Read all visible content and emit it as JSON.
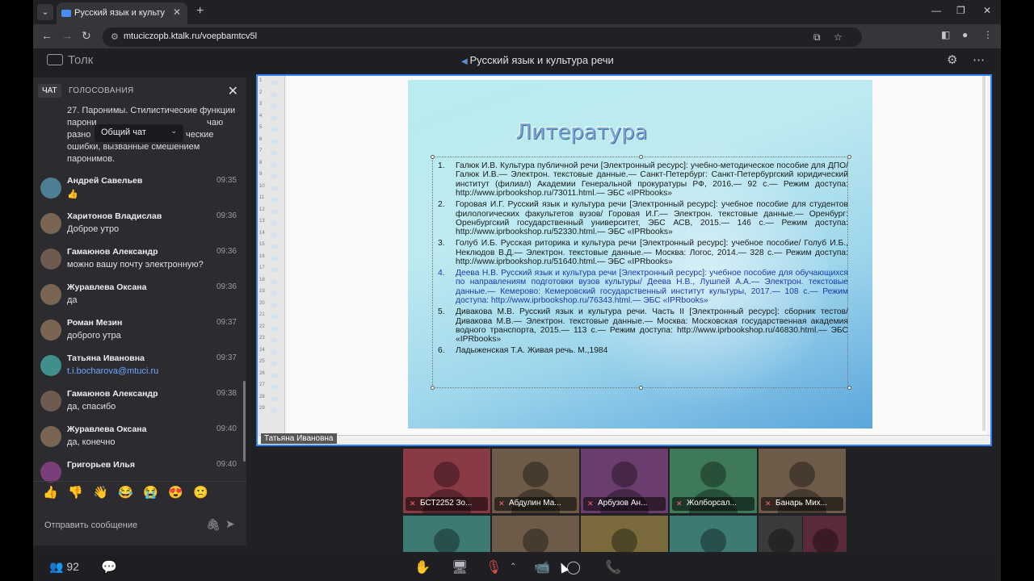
{
  "browser": {
    "tab_title": "Русский язык и культура р",
    "url": "mtuciczopb.ktalk.ru/voepbamtcv5l"
  },
  "app": {
    "logo_text": "Толк",
    "meeting_title": "Русский язык и культура речи"
  },
  "chat": {
    "tab_active": "ЧАТ",
    "tab_polls": "ГОЛОСОВАНИЯ",
    "selector": "Общий чат",
    "first_message_lines": [
      "27. Паронимы. Стилистические функции",
      "парони",
      "разно",
      "ошибки, вызванные смешением",
      "паронимов."
    ],
    "first_message_tails": [
      "чаю",
      "ческие"
    ],
    "messages": [
      {
        "name": "Андрей Савельев",
        "time": "09:35",
        "text": "👍",
        "color": "#4d7e93"
      },
      {
        "name": "Харитонов Владислав",
        "time": "09:36",
        "text": "Доброе утро",
        "color": "#7a6553"
      },
      {
        "name": "Гамаюнов Александр",
        "time": "09:36",
        "text": "можно вашу почту электронную?",
        "color": "#6e5a4e"
      },
      {
        "name": "Журавлева Оксана",
        "time": "09:36",
        "text": "да",
        "color": "#7a6553"
      },
      {
        "name": "Роман Мезин",
        "time": "09:37",
        "text": "доброго утра",
        "color": "#7a6553"
      },
      {
        "name": "Татьяна Ивановна",
        "time": "09:37",
        "text": "t.i.bocharova@mtuci.ru",
        "color": "#3f8f8b"
      },
      {
        "name": "Гамаюнов Александр",
        "time": "09:38",
        "text": "да, спасибо",
        "color": "#6e5a4e"
      },
      {
        "name": "Журавлева Оксана",
        "time": "09:40",
        "text": "да, конечно",
        "color": "#7a6553"
      },
      {
        "name": "Григорьев Илья",
        "time": "09:40",
        "text": "",
        "color": "#7a3f7a"
      }
    ],
    "reactions": [
      "👍",
      "👎",
      "👋",
      "😂",
      "😭",
      "😍",
      "🙁"
    ],
    "input_placeholder": "Отправить сообщение"
  },
  "slide": {
    "title": "Литература",
    "speaker": "Татьяна Ивановна",
    "references": [
      {
        "num": "1.",
        "text": "Галюк И.В. Культура публичной речи [Электронный ресурс]: учебно-методическое пособие для ДПО/ Галюк И.В.— Электрон. текстовые данные.— Санкт-Петербург: Санкт-Петербургский юридический институт (филиал) Академии Генеральной прокуратуры РФ, 2016.— 92 c.— Режим доступа: http://www.iprbookshop.ru/73011.html.— ЭБС «IPRbooks»"
      },
      {
        "num": "2.",
        "text": "Горовая И.Г. Русский язык и культура речи [Электронный ресурс]: учебное пособие для студентов филологических факультетов вузов/ Горовая И.Г.— Электрон. текстовые данные.— Оренбург: Оренбургский государственный университет, ЭБС АСВ, 2015.— 146 c.— Режим доступа: http://www.iprbookshop.ru/52330.html.— ЭБС «IPRbooks»"
      },
      {
        "num": "3.",
        "text": "Голуб И.Б. Русская риторика и культура речи [Электронный ресурс]: учебное пособие/ Голуб И.Б., Неклюдов В.Д.— Электрон. текстовые данные.— Москва: Логос, 2014.— 328 c.— Режим доступа: http://www.iprbookshop.ru/51640.html.— ЭБС «IPRbooks»"
      },
      {
        "num": "4.",
        "text": "Деева Н.В. Русский язык и культура речи [Электронный ресурс]: учебное пособие для обучающихся по направлениям подготовки вузов культуры/ Деева Н.В., Лушпей А.А.— Электрон. текстовые данные.— Кемерово: Кемеровский государственный институт культуры, 2017.— 108 c.— Режим доступа: http://www.iprbookshop.ru/76343.html.— ЭБС «IPRbooks»"
      },
      {
        "num": "5.",
        "text": "Дивакова М.В. Русский язык и культура речи. Часть II [Электронный ресурс]: сборник тестов/ Дивакова М.В.— Электрон. текстовые данные.— Москва: Московская государственная академия водного транспорта, 2015.— 113 c.— Режим доступа: http://www.iprbookshop.ru/46830.html.— ЭБС «IPRbooks»"
      },
      {
        "num": "6.",
        "text": "Ладыженская Т.А. Живая речь. М.,1984"
      }
    ]
  },
  "participants": [
    {
      "name": "БСТ2252 Зо...",
      "color": "#8a3a45"
    },
    {
      "name": "Абдулин Ма...",
      "color": "#6e5a48"
    },
    {
      "name": "Арбузов Ан...",
      "color": "#6a3d6e"
    },
    {
      "name": "Жолборсал...",
      "color": "#3e7a57"
    },
    {
      "name": "Банарь Мих...",
      "color": "#6e5a48"
    }
  ],
  "participants_row2": [
    "#3d7a74",
    "#6e5a48",
    "#7a6a3c",
    "#3d7a74",
    "#3a3a3a",
    "#5a2a3a"
  ],
  "toolbar": {
    "participant_count": "92"
  }
}
